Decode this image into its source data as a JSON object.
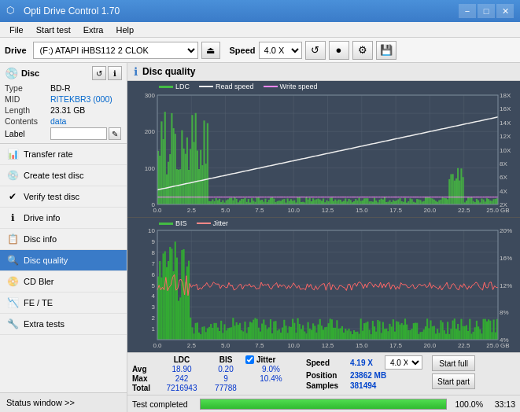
{
  "titlebar": {
    "title": "Opti Drive Control 1.70",
    "min_label": "−",
    "max_label": "□",
    "close_label": "✕"
  },
  "menubar": {
    "items": [
      "File",
      "Start test",
      "Extra",
      "Help"
    ]
  },
  "toolbar": {
    "drive_label": "Drive",
    "drive_value": "(F:)  ATAPI iHBS112  2 CLOK",
    "speed_label": "Speed",
    "speed_value": "4.0 X"
  },
  "disc": {
    "title": "Disc",
    "type_label": "Type",
    "type_value": "BD-R",
    "mid_label": "MID",
    "mid_value": "RITEKBR3 (000)",
    "length_label": "Length",
    "length_value": "23.31 GB",
    "contents_label": "Contents",
    "contents_value": "data",
    "label_label": "Label",
    "label_value": ""
  },
  "nav": {
    "items": [
      {
        "id": "transfer-rate",
        "label": "Transfer rate",
        "icon": "📊"
      },
      {
        "id": "create-test-disc",
        "label": "Create test disc",
        "icon": "💿"
      },
      {
        "id": "verify-test-disc",
        "label": "Verify test disc",
        "icon": "✔"
      },
      {
        "id": "drive-info",
        "label": "Drive info",
        "icon": "ℹ"
      },
      {
        "id": "disc-info",
        "label": "Disc info",
        "icon": "📋"
      },
      {
        "id": "disc-quality",
        "label": "Disc quality",
        "icon": "🔍",
        "active": true
      },
      {
        "id": "cd-bler",
        "label": "CD Bler",
        "icon": "📀"
      },
      {
        "id": "fe-te",
        "label": "FE / TE",
        "icon": "📉"
      },
      {
        "id": "extra-tests",
        "label": "Extra tests",
        "icon": "🔧"
      }
    ],
    "status_window": "Status window >>"
  },
  "disc_quality": {
    "title": "Disc quality",
    "legend_top": [
      "LDC",
      "Read speed",
      "Write speed"
    ],
    "legend_bottom": [
      "BIS",
      "Jitter"
    ],
    "y_axis_top": [
      "300",
      "200",
      "100"
    ],
    "y_axis_top_right": [
      "18X",
      "16X",
      "14X",
      "12X",
      "10X",
      "8X",
      "6X",
      "4X",
      "2X"
    ],
    "y_axis_bottom": [
      "10",
      "9",
      "8",
      "7",
      "6",
      "5",
      "4",
      "3",
      "2",
      "1"
    ],
    "y_axis_bottom_right": [
      "20%",
      "16%",
      "12%",
      "8%",
      "4%"
    ],
    "x_axis": [
      "0.0",
      "2.5",
      "5.0",
      "7.5",
      "10.0",
      "12.5",
      "15.0",
      "17.5",
      "20.0",
      "22.5",
      "25.0 GB"
    ]
  },
  "stats": {
    "headers": [
      "LDC",
      "BIS",
      "Jitter"
    ],
    "rows": [
      {
        "label": "Avg",
        "ldc": "18.90",
        "bis": "0.20",
        "jitter": "9.0%"
      },
      {
        "label": "Max",
        "ldc": "242",
        "bis": "9",
        "jitter": "10.4%"
      },
      {
        "label": "Total",
        "ldc": "7216943",
        "bis": "77788",
        "jitter": ""
      }
    ],
    "jitter_checked": true,
    "speed_label": "Speed",
    "speed_value": "4.19 X",
    "speed_select": "4.0 X",
    "position_label": "Position",
    "position_value": "23862 MB",
    "samples_label": "Samples",
    "samples_value": "381494",
    "start_full": "Start full",
    "start_part": "Start part"
  },
  "progress": {
    "status": "Test completed",
    "percent": "100.0%",
    "fill_width": 100,
    "time": "33:13"
  }
}
